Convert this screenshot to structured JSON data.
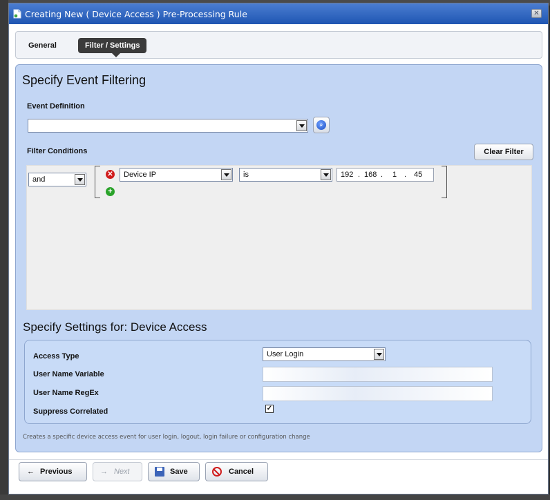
{
  "dialog": {
    "title": "Creating New ( Device Access ) Pre-Processing Rule",
    "close_glyph": "✕"
  },
  "tabs": {
    "general": "General",
    "filter_settings": "Filter / Settings",
    "active": "filter_settings"
  },
  "filtering": {
    "heading": "Specify Event Filtering",
    "event_definition_label": "Event Definition",
    "event_definition_value": "",
    "search_glyph": "⌕",
    "filter_conditions_label": "Filter Conditions",
    "clear_filter_label": "Clear Filter",
    "condition_group": {
      "operator": "and",
      "rows": [
        {
          "field": "Device IP",
          "comparator": "is",
          "ip": [
            "192",
            "168",
            "1",
            "45"
          ]
        }
      ]
    },
    "remove_glyph": "✕",
    "add_glyph": "+"
  },
  "settings": {
    "heading": "Specify Settings for: Device Access",
    "access_type_label": "Access Type",
    "access_type_value": "User Login",
    "user_name_variable_label": "User Name Variable",
    "user_name_variable_value": "",
    "user_name_regex_label": "User Name RegEx",
    "user_name_regex_value": "",
    "suppress_correlated_label": "Suppress Correlated",
    "suppress_correlated_checked": true,
    "check_glyph": "✓"
  },
  "description": "Creates a specific device access event for user login, logout, login failure or configuration change",
  "footer": {
    "previous_label": "Previous",
    "previous_glyph": "←",
    "next_label": "Next",
    "next_glyph": "→",
    "save_label": "Save",
    "cancel_label": "Cancel"
  },
  "colors": {
    "titlebar": "#2a62c4",
    "panel": "#c3d6f4",
    "condition_area": "#efefef",
    "active_tab": "#3b3b3b"
  }
}
